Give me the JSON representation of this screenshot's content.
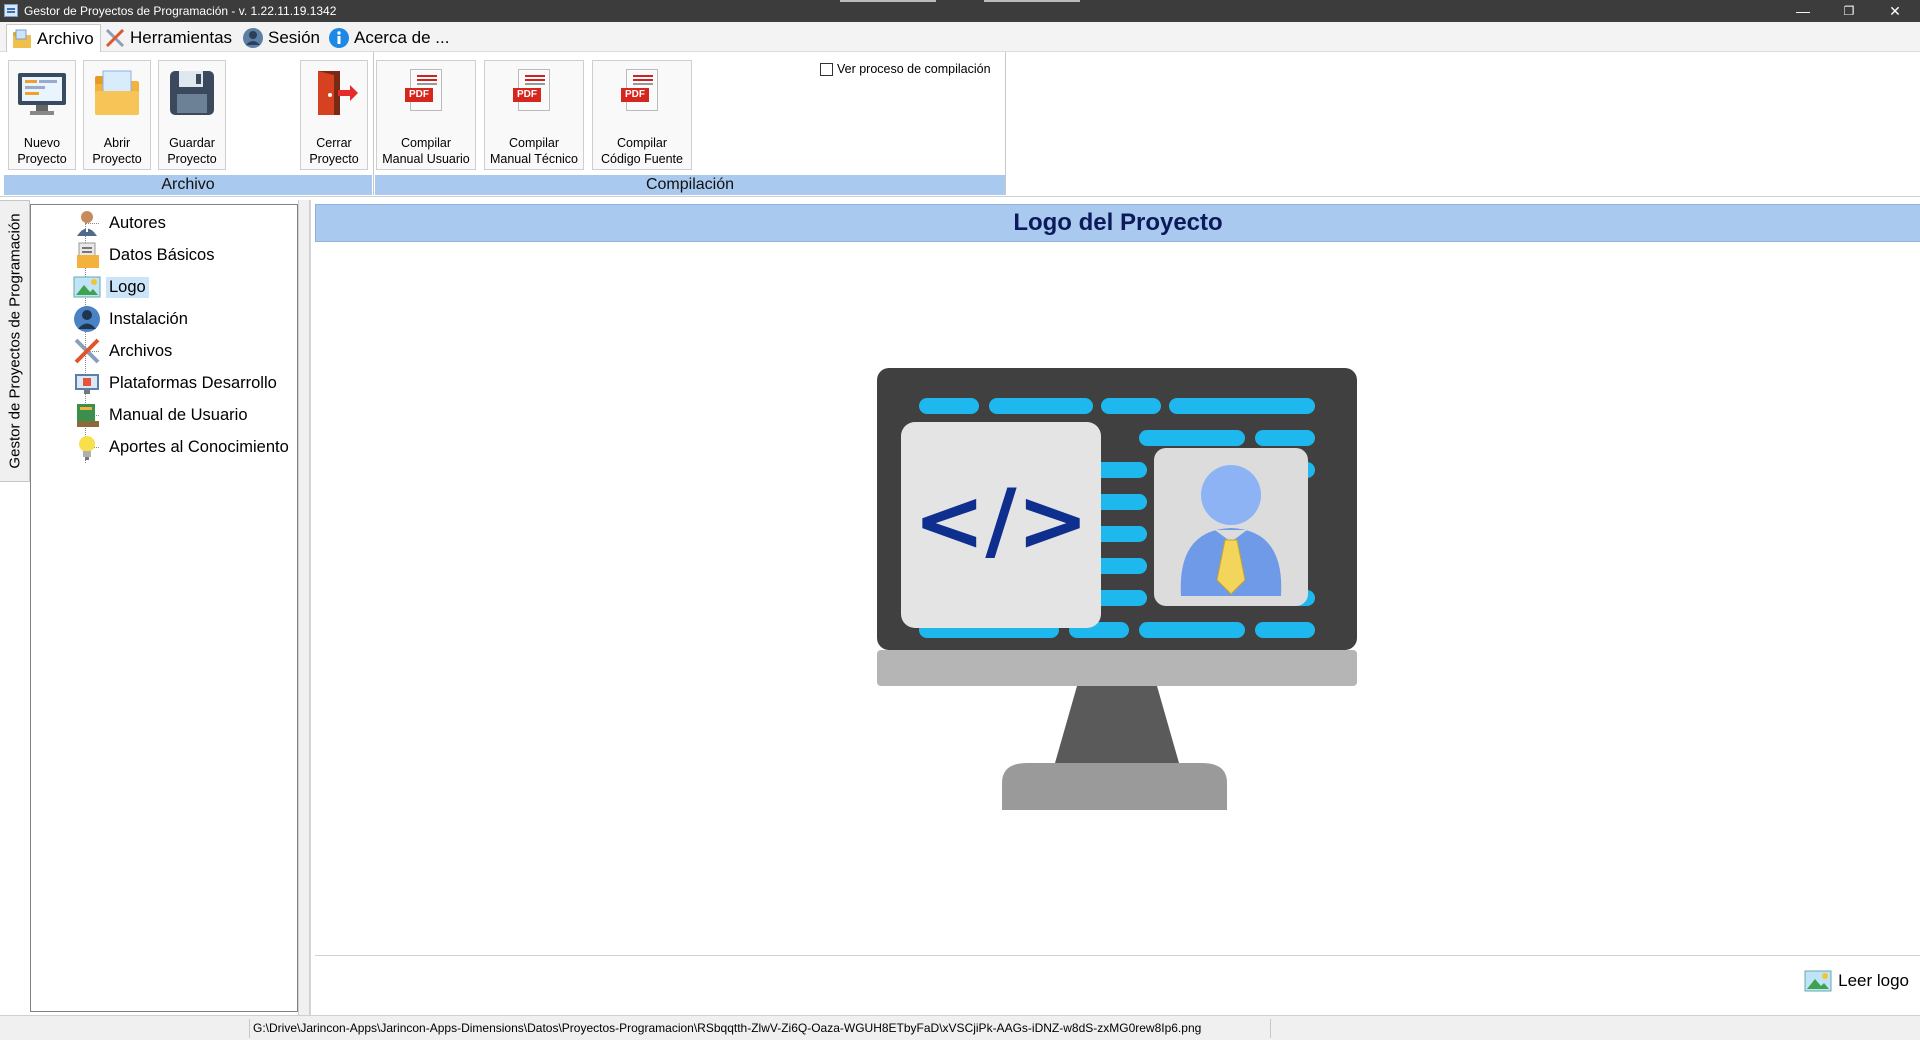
{
  "window": {
    "title": "Gestor de Proyectos de Programación - v. 1.22.11.19.1342",
    "controls": {
      "minimize": "—",
      "restore": "❐",
      "close": "✕"
    }
  },
  "menu": {
    "tabs": [
      {
        "label": "Archivo",
        "icon": "folder-icon",
        "active": true
      },
      {
        "label": "Herramientas",
        "icon": "tools-icon",
        "active": false
      },
      {
        "label": "Sesión",
        "icon": "user-icon",
        "active": false
      },
      {
        "label": "Acerca de ...",
        "icon": "info-icon",
        "active": false
      }
    ]
  },
  "ribbon": {
    "buttons": [
      {
        "label_line1": "Nuevo",
        "label_line2": "Proyecto",
        "icon": "new-project-icon"
      },
      {
        "label_line1": "Abrir",
        "label_line2": "Proyecto",
        "icon": "open-project-icon"
      },
      {
        "label_line1": "Guardar",
        "label_line2": "Proyecto",
        "icon": "save-icon"
      },
      {
        "label_line1": "Cerrar",
        "label_line2": "Proyecto",
        "icon": "exit-door-icon"
      },
      {
        "label_line1": "Compilar",
        "label_line2": "Manual Usuario",
        "icon": "pdf-icon"
      },
      {
        "label_line1": "Compilar",
        "label_line2": "Manual Técnico",
        "icon": "pdf-icon"
      },
      {
        "label_line1": "Compilar",
        "label_line2": "Código Fuente",
        "icon": "pdf-icon"
      }
    ],
    "groups": {
      "archivo": "Archivo",
      "compilacion": "Compilación"
    },
    "compile_checkbox": {
      "label": "Ver proceso de compilación",
      "checked": false
    }
  },
  "sidebar": {
    "vertical_tab": "Gestor de Proyectos de Programación",
    "items": [
      {
        "label": "Autores",
        "icon": "author-icon",
        "selected": false
      },
      {
        "label": "Datos Básicos",
        "icon": "documents-icon",
        "selected": false
      },
      {
        "label": "Logo",
        "icon": "image-icon",
        "selected": true
      },
      {
        "label": "Instalación",
        "icon": "installer-icon",
        "selected": false
      },
      {
        "label": "Archivos",
        "icon": "tools-icon",
        "selected": false
      },
      {
        "label": "Plataformas Desarrollo",
        "icon": "platform-icon",
        "selected": false
      },
      {
        "label": "Manual de Usuario",
        "icon": "books-icon",
        "selected": false
      },
      {
        "label": "Aportes al Conocimiento",
        "icon": "lightbulb-icon",
        "selected": false
      }
    ]
  },
  "main": {
    "section_title": "Logo del Proyecto",
    "logo": {
      "code_symbol": "</>",
      "description_icon": "monitor-code-user-icon"
    },
    "read_logo_button": "Leer logo"
  },
  "status": {
    "path": "G:\\Drive\\Jarincon-Apps\\Jarincon-Apps-Dimensions\\Datos\\Proyectos-Programacion\\RSbqqtth-ZlwV-Zi6Q-Oaza-WGUH8ETbyFaD\\xVSCjiPk-AAGs-iDNZ-w8dS-zxMG0rew8Ip6.png"
  },
  "colors": {
    "titlebar": "#3c3c3c",
    "ribbon_group": "#a9c9ef",
    "header_text": "#0c1a5c",
    "logo_screen": "#3f3f3f",
    "logo_bars": "#1fb8ee"
  }
}
